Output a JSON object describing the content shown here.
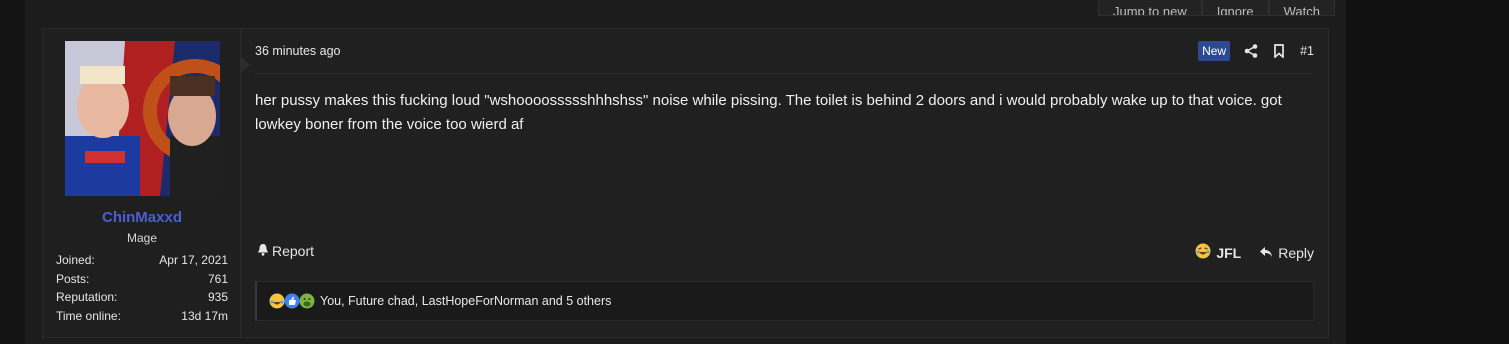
{
  "topbar": {
    "buttons": [
      "Jump to new",
      "Ignore",
      "Watch"
    ]
  },
  "post": {
    "user": {
      "name": "ChinMaxxd",
      "title": "Mage",
      "stats": [
        {
          "label": "Joined:",
          "value": "Apr 17, 2021"
        },
        {
          "label": "Posts:",
          "value": "761"
        },
        {
          "label": "Reputation:",
          "value": "935"
        },
        {
          "label": "Time online:",
          "value": "13d 17m"
        }
      ]
    },
    "date": "36 minutes ago",
    "badge_new": "New",
    "post_number": "#1",
    "message": "her pussy makes this fucking loud \"wshoooossssshhhshss\" noise while pissing. The toilet is behind 2 doors and i would probably wake up to that voice. got lowkey boner from the voice too wierd af",
    "actions": {
      "report": "Report",
      "jfl": "JFL",
      "reply": "Reply"
    },
    "reactions_text": "You, Future chad, LastHopeForNorman and 5 others"
  },
  "colors": {
    "username": "#4a5fd1",
    "badge_new": "#2d4a8f"
  },
  "icons": [
    "share-icon",
    "bookmark-icon",
    "bell-icon",
    "reply-icon",
    "laughing-emoji-icon",
    "thumbs-up-icon",
    "vomit-emoji-icon"
  ]
}
